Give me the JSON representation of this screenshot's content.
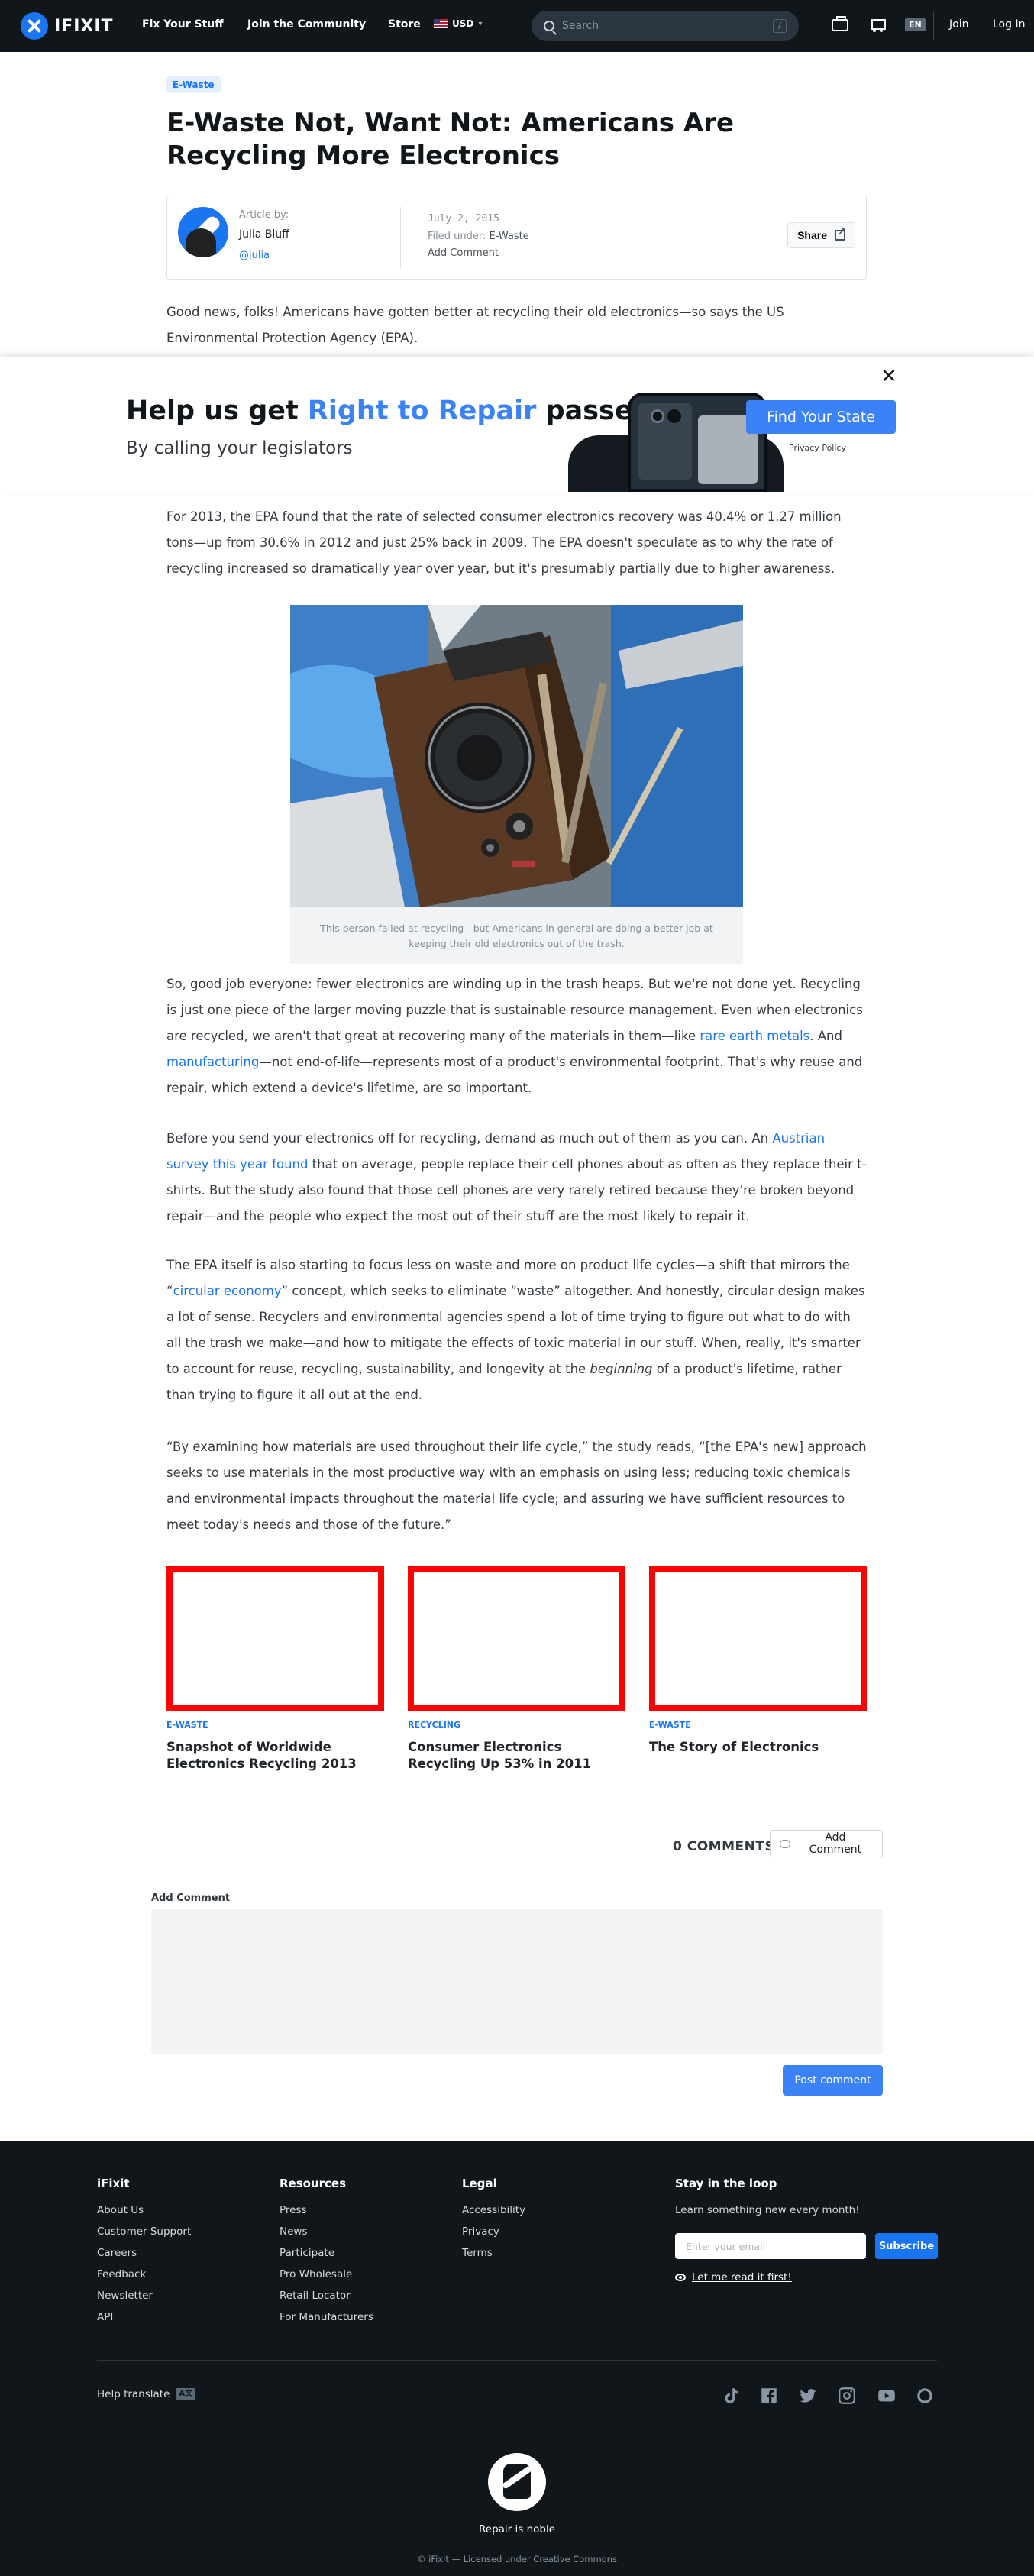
{
  "header": {
    "logo_text": "IFIXIT",
    "nav": [
      "Fix Your Stuff",
      "Join the Community",
      "Store"
    ],
    "currency": "USD",
    "search_placeholder": "Search",
    "search_shortcut": "/",
    "language": "EN",
    "join": "Join",
    "login": "Log In"
  },
  "article": {
    "tag": "E-Waste",
    "title": "E-Waste Not, Want Not: Americans Are Recycling More Electronics",
    "byline": {
      "label": "Article by:",
      "author": "Julia Bluff",
      "handle": "@julia",
      "date": "July 2, 2015",
      "filed_label": "Filed under:",
      "filed_value": "E-Waste",
      "add_comment": "Add Comment",
      "share": "Share"
    },
    "intro": "Good news, folks! Americans have gotten better at recycling their old electronics—so says the US Environmental Protection Agency (EPA).",
    "p1": "For 2013, the EPA found that the rate of selected consumer electronics recovery was 40.4% or 1.27 million tons—up from 30.6% in 2012 and just 25% back in 2009. The EPA doesn't speculate as to why the rate of recycling increased so dramatically year over year, but it's presumably partially due to higher awareness.",
    "figure_caption": "This person failed at recycling—but Americans in general are doing a better job at keeping their old electronics out of the trash.",
    "p2": {
      "a": "So, good job everyone: fewer electronics are winding up in the trash heaps. But we're not done yet. Recycling is just one piece of the larger moving puzzle that is sustainable resource management. Even when electronics are recycled, we aren't that great at recovering many of the materials in them—like ",
      "link1": "rare earth metals",
      "b": ". And ",
      "link2": "manufacturing",
      "c": "—not end-of-life—represents most of a product's environmental footprint. That's why reuse and repair, which extend a device's lifetime, are so important."
    },
    "p3": {
      "a": "Before you send your electronics off for recycling, demand as much out of them as you can. An ",
      "link": "Austrian survey this year found",
      "b": " that on average, people replace their cell phones about as often as they replace their t-shirts. But the study also found that those cell phones are very rarely retired because they're broken beyond repair—and the people who expect the most out of their stuff are the most likely to repair it."
    },
    "p4": {
      "a": "The EPA itself is also starting to focus less on waste and more on product life cycles—a shift that mirrors the “",
      "link": "circular economy",
      "b": "” concept, which seeks to eliminate “waste” altogether. And honestly, circular design makes a lot of sense. Recyclers and environmental agencies spend a lot of time trying to figure out what to do with all the trash we make—and how to mitigate the effects of toxic material in our stuff. When, really, it's smarter to account for reuse, recycling, sustainability, and longevity at the ",
      "em": "beginning",
      "c": " of a product's lifetime, rather than trying to figure it all out at the end."
    },
    "p5": "“By examining how materials are used throughout their life cycle,” the study reads, “[the EPA's new] approach seeks to use materials in the most productive way with an emphasis on using less; reducing toxic chemicals and environmental impacts throughout the material life cycle; and assuring we have sufficient resources to meet today's needs and those of the future.”"
  },
  "promo": {
    "headline_a": "Help us get ",
    "headline_hl": "Right to Repair",
    "headline_b": " passed",
    "sub": "By calling your legislators",
    "cta": "Find Your State",
    "privacy": "Privacy Policy",
    "close": "✕"
  },
  "related": [
    {
      "tag": "E-WASTE",
      "title": "Snapshot of Worldwide Electronics Recycling 2013"
    },
    {
      "tag": "RECYCLING",
      "title": "Consumer Electronics Recycling Up 53% in 2011"
    },
    {
      "tag": "E-WASTE",
      "title": "The Story of Electronics"
    }
  ],
  "comments": {
    "count": "0 COMMENTS",
    "add_btn": "Add Comment",
    "label": "Add Comment",
    "post": "Post comment"
  },
  "footer": {
    "col1": {
      "heading": "iFixit",
      "items": [
        "About Us",
        "Customer Support",
        "Careers",
        "Feedback",
        "Newsletter",
        "API"
      ]
    },
    "col2": {
      "heading": "Resources",
      "items": [
        "Press",
        "News",
        "Participate",
        "Pro Wholesale",
        "Retail Locator",
        "For Manufacturers"
      ]
    },
    "col3": {
      "heading": "Legal",
      "items": [
        "Accessibility",
        "Privacy",
        "Terms"
      ]
    },
    "loop": {
      "heading": "Stay in the loop",
      "sub": "Learn something new every month!",
      "placeholder": "Enter your email",
      "subscribe": "Subscribe",
      "read_first": "Let me read it first!"
    },
    "help_translate": "Help translate",
    "translate_badge": "A文",
    "tagline": "Repair is noble",
    "license": "© iFixit — Licensed under Creative Commons"
  }
}
